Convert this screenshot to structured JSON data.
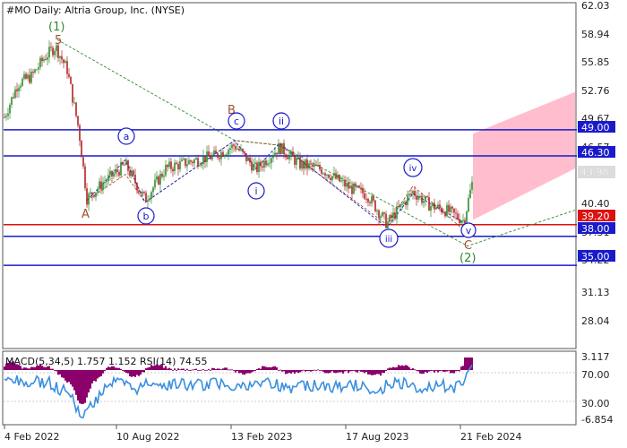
{
  "header": {
    "symbol": "#MO",
    "timeframe": "Daily:",
    "instrument": "Altria Group, Inc. (NYSE)"
  },
  "price_axis": {
    "ticks": [
      "62.03",
      "58.94",
      "55.85",
      "52.76",
      "49.67",
      "46.57",
      "43.98",
      "40.40",
      "37.31",
      "34.22",
      "31.13",
      "28.04"
    ],
    "current_price": "43.98"
  },
  "levels": [
    {
      "label": "49.00",
      "value": 49.0,
      "color": "#1a1acc"
    },
    {
      "label": "46.30",
      "value": 46.3,
      "color": "#1a1acc"
    },
    {
      "label": "39.20",
      "value": 39.2,
      "color": "#dd1111"
    },
    {
      "label": "38.00",
      "value": 38.0,
      "color": "#1a1acc"
    },
    {
      "label": "35.00",
      "value": 35.0,
      "color": "#1a1acc"
    }
  ],
  "date_axis": {
    "ticks": [
      "4 Feb 2022",
      "10 Aug 2022",
      "13 Feb 2023",
      "17 Aug 2023",
      "21 Feb 2024"
    ]
  },
  "wave_labels": {
    "primary_1": "(1)",
    "primary_2": "(2)",
    "intermediate_5": "5",
    "corr_A": "A",
    "corr_B": "B",
    "corr_C": "C",
    "sub_a": "a",
    "sub_b": "b",
    "sub_c": "c",
    "minor_i": "i",
    "minor_ii": "ii",
    "minor_iii": "iii",
    "minor_iv": "iv",
    "minor_v": "v"
  },
  "indicator": {
    "caption": "MACD(5,34,5) 1.757 1.152 RSI(14) 74.55",
    "ticks": [
      "3.117",
      "70.00",
      "30.00",
      "-6.854"
    ]
  },
  "colors": {
    "candle_up": "#2e8b2e",
    "candle_down": "#b22222",
    "macd_hist": "#8b006b",
    "rsi_line": "#3a8fdf",
    "forecast_zone": "#ffb6c8",
    "wave_green": "#2e8b2e",
    "wave_brown": "#a0522d",
    "wave_blue": "#1a1acc"
  },
  "chart_data": {
    "type": "line",
    "title": "#MO, Daily: Altria Group, Inc. (NYSE)",
    "y_axis_range": [
      26.5,
      62.03
    ],
    "x_ticks": [
      "4 Feb 2022",
      "10 Aug 2022",
      "13 Feb 2023",
      "17 Aug 2023",
      "21 Feb 2024"
    ],
    "series": [
      {
        "name": "#MO",
        "points": [
          {
            "x": "4 Feb 2022",
            "y": 50.5
          },
          {
            "x": "Apr 2022",
            "y": 57.9
          },
          {
            "x": "Jul 2022",
            "y": 41.8
          },
          {
            "x": "10 Aug 2022",
            "y": 44.3
          },
          {
            "x": "Oct 2022",
            "y": 41.7
          },
          {
            "x": "Dec 2022",
            "y": 46.5
          },
          {
            "x": "13 Feb 2023",
            "y": 47.4
          },
          {
            "x": "Apr 2023",
            "y": 44.6
          },
          {
            "x": "May 2023",
            "y": 47.1
          },
          {
            "x": "17 Aug 2023",
            "y": 42.6
          },
          {
            "x": "Oct 2023",
            "y": 38.9
          },
          {
            "x": "Nov 2023",
            "y": 42.2
          },
          {
            "x": "Jan 2024",
            "y": 39.7
          },
          {
            "x": "21 Feb 2024",
            "y": 43.98
          }
        ]
      }
    ],
    "horizontal_levels": [
      49.0,
      46.3,
      39.2,
      38.0,
      35.0
    ],
    "oscillator_range": [
      -6.854,
      3.117
    ]
  }
}
